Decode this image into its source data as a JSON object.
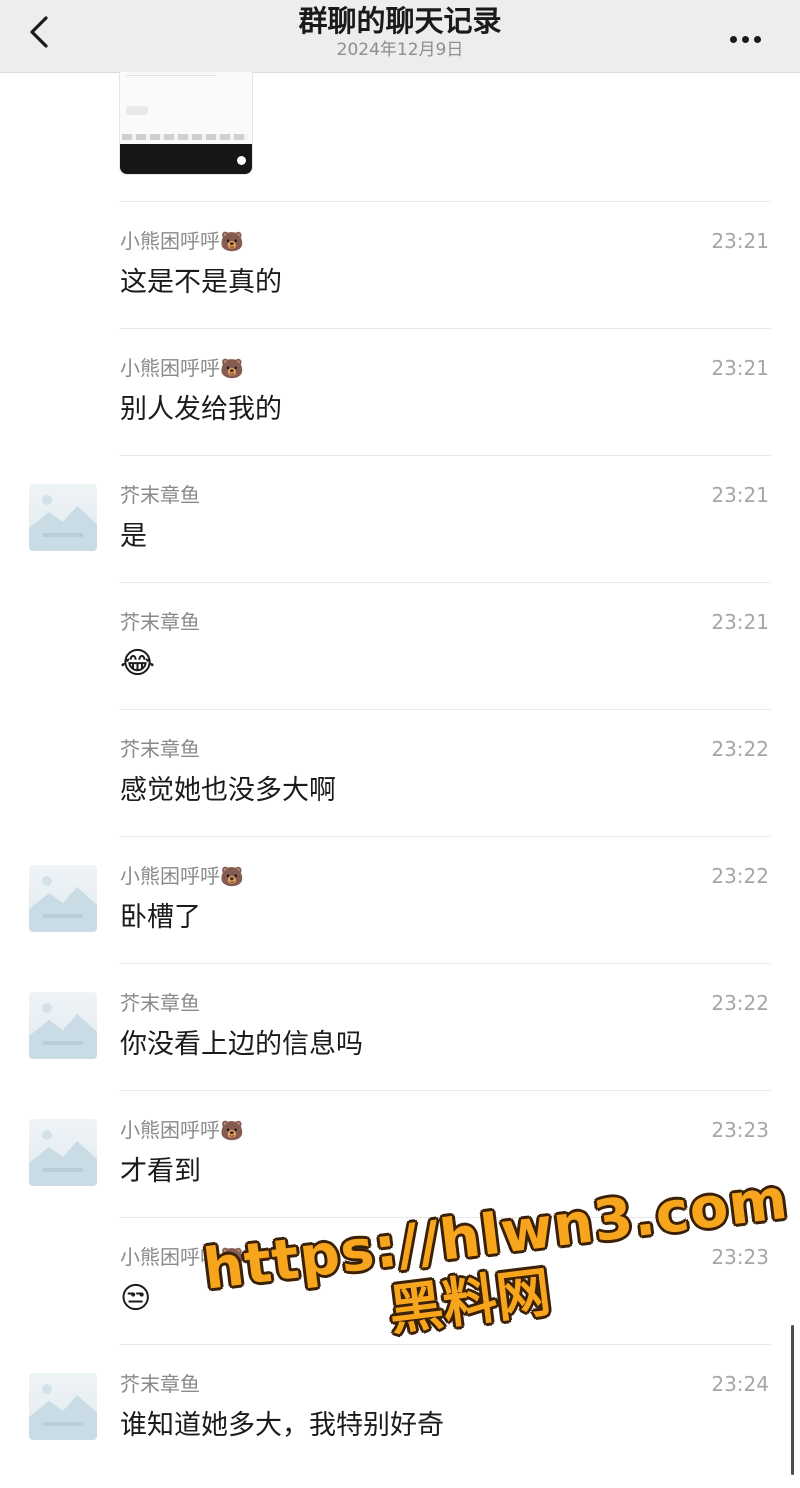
{
  "header": {
    "title": "群聊的聊天记录",
    "date": "2024年12月9日"
  },
  "messages": [
    {
      "sender": "小熊困呼呼",
      "sender_badge": "🐻",
      "time": "23:21",
      "text": "这是不是真的",
      "avatar": false
    },
    {
      "sender": "小熊困呼呼",
      "sender_badge": "🐻",
      "time": "23:21",
      "text": "别人发给我的",
      "avatar": false
    },
    {
      "sender": "芥末章鱼",
      "sender_badge": "",
      "time": "23:21",
      "text": "是",
      "avatar": true
    },
    {
      "sender": "芥末章鱼",
      "sender_badge": "",
      "time": "23:21",
      "text": "😂",
      "avatar": false
    },
    {
      "sender": "芥末章鱼",
      "sender_badge": "",
      "time": "23:22",
      "text": "感觉她也没多大啊",
      "avatar": false
    },
    {
      "sender": "小熊困呼呼",
      "sender_badge": "🐻",
      "time": "23:22",
      "text": "卧槽了",
      "avatar": true
    },
    {
      "sender": "芥末章鱼",
      "sender_badge": "",
      "time": "23:22",
      "text": "你没看上边的信息吗",
      "avatar": true
    },
    {
      "sender": "小熊困呼呼",
      "sender_badge": "🐻",
      "time": "23:23",
      "text": "才看到",
      "avatar": true
    },
    {
      "sender": "小熊困呼呼",
      "sender_badge": "🐻",
      "time": "23:23",
      "text": "😒",
      "avatar": false
    },
    {
      "sender": "芥末章鱼",
      "sender_badge": "",
      "time": "23:24",
      "text": "谁知道她多大，我特别好奇",
      "avatar": true
    }
  ],
  "watermark": {
    "line1": "https://hlwn3.com",
    "line2": "黑料网"
  },
  "icons": {
    "back": "chevron-left-icon",
    "more": "more-dots-icon"
  },
  "colors": {
    "header_bg": "#ededed",
    "watermark": "#f7a51d"
  }
}
